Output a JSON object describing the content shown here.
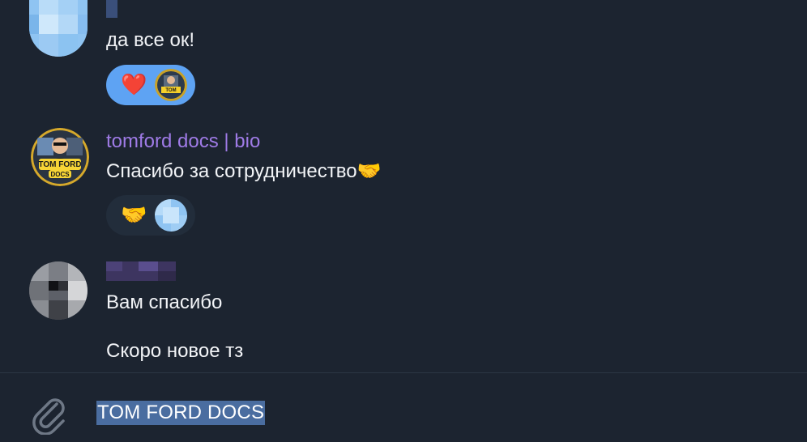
{
  "messages": [
    {
      "text": "да все ок!"
    },
    {
      "sender": "tomford docs | bio",
      "text": "Спасибо за сотрудничество🤝"
    },
    {
      "text_1": "Вам спасибо",
      "text_2": "Скоро новое тз"
    }
  ],
  "reactions": [
    {
      "emoji": "❤️",
      "color": "#5ea3f3"
    },
    {
      "emoji": "🤝",
      "color": "#222d3b"
    }
  ],
  "avatar_badge": {
    "line1": "TOM FORD",
    "line2": "DOCS"
  },
  "composer": {
    "input_value": "TOM FORD DOCS",
    "attach_icon": "paperclip-icon"
  },
  "colors": {
    "background": "#1c2430",
    "sender_name": "#9f7be6",
    "selection": "#4a6da0",
    "reaction_active": "#5ea3f3"
  }
}
